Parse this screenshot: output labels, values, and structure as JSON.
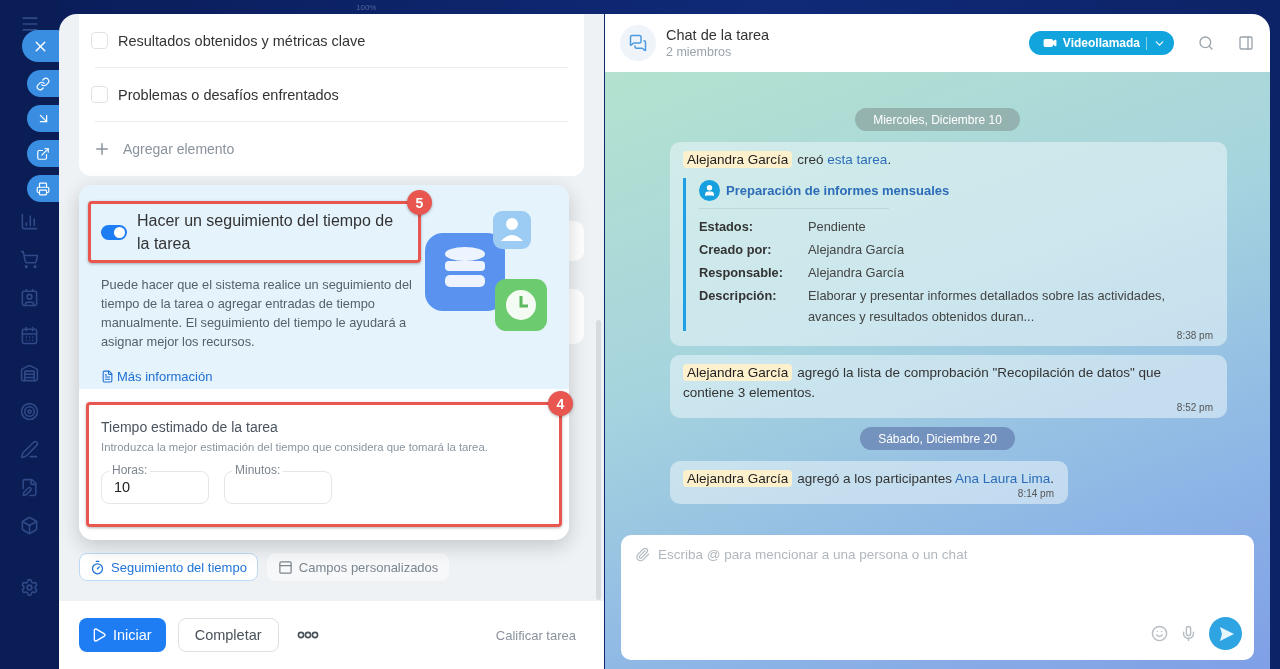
{
  "zoom_label": "100%",
  "checklist": {
    "items": [
      {
        "label": "Resultados obtenidos y métricas clave",
        "checked": false
      },
      {
        "label": "Problemas o desafíos enfrentados",
        "checked": false
      }
    ],
    "add_label": "Agregar elemento"
  },
  "time_tracking": {
    "badge": "5",
    "on": true,
    "title": "Hacer un seguimiento del tiempo de la tarea",
    "description": "Puede hacer que el sistema realice un seguimiento del tiempo de la tarea o agregar entradas de tiempo manualmente. El seguimiento del tiempo le ayudará a asignar mejor los recursos.",
    "link": "Más información",
    "estimate": {
      "badge": "4",
      "title": "Tiempo estimado de la tarea",
      "hint": "Introduzca la mejor estimación del tiempo que considera que tomará la tarea.",
      "fields": [
        {
          "label": "Horas:",
          "value": "10"
        },
        {
          "label": "Minutos:"
        }
      ]
    }
  },
  "tabs": [
    {
      "label": "Seguimiento del tiempo",
      "selected": true
    },
    {
      "label": "Campos personalizados",
      "selected": false
    }
  ],
  "footer": {
    "start": "Iniciar",
    "complete": "Completar",
    "rate": "Calificar tarea"
  },
  "chat": {
    "title": "Chat de la tarea",
    "members": "2 miembros",
    "call_button": "Videollamada",
    "messages": [
      {
        "kind": "date",
        "text": "Miercoles, Diciembre 10"
      },
      {
        "kind": "task",
        "parts": [
          {
            "kind": "mention",
            "text": "Alejandra García"
          },
          {
            "kind": "text",
            "text": "creó "
          },
          {
            "kind": "link",
            "text": "esta tarea"
          },
          {
            "kind": "text",
            "text": "."
          }
        ],
        "task": {
          "title": "Preparación de informes mensuales",
          "fields": [
            {
              "label": "Estados:",
              "value": "Pendiente"
            },
            {
              "label": "Creado por:",
              "value": "Alejandra García"
            },
            {
              "label": "Responsable:",
              "value": "Alejandra García"
            },
            {
              "label": "Descripción:",
              "value": "Elaborar y presentar informes detallados sobre las actividades, avances y resultados obtenidos duran..."
            }
          ]
        },
        "time": "8:38 pm"
      },
      {
        "kind": "event",
        "parts": [
          {
            "kind": "mention",
            "text": "Alejandra García"
          },
          {
            "kind": "text",
            "text": "agregó la lista de comprobación \"Recopilación de datos\" que contiene 3 elementos."
          }
        ],
        "time": "8:52 pm"
      },
      {
        "kind": "date",
        "text": "Sábado, Diciembre 20"
      },
      {
        "kind": "event",
        "parts": [
          {
            "kind": "mention",
            "text": "Alejandra García"
          },
          {
            "kind": "text",
            "text": "agregó a los participantes "
          },
          {
            "kind": "link",
            "text": "Ana Laura Lima"
          },
          {
            "kind": "text",
            "text": "."
          }
        ],
        "time": "8:14 pm"
      }
    ],
    "input": {
      "placeholder": "Escriba @ para mencionar a una persona o un chat"
    }
  }
}
